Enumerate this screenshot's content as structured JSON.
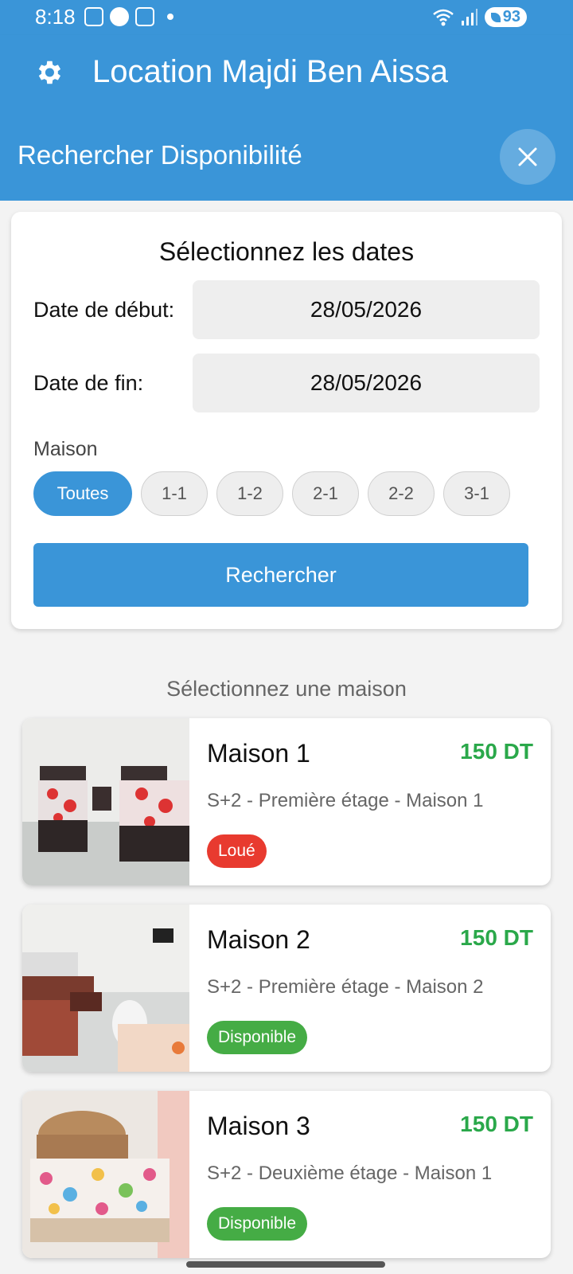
{
  "status_bar": {
    "time": "8:18",
    "battery": "93"
  },
  "app_bar": {
    "title": "Location Majdi Ben Aissa",
    "settings_icon": "gear-icon"
  },
  "sub_header": {
    "title": "Rechercher Disponibilité",
    "close_icon": "close-icon"
  },
  "date_card": {
    "title": "Sélectionnez les dates",
    "start_label": "Date de début:",
    "start_value": "28/05/2026",
    "end_label": "Date de fin:",
    "end_value": "28/05/2026",
    "maison_label": "Maison",
    "chips": [
      "Toutes",
      "1-1",
      "1-2",
      "2-1",
      "2-2",
      "3-1"
    ],
    "selected_chip": "Toutes",
    "search_label": "Rechercher"
  },
  "list": {
    "section_label": "Sélectionnez une maison",
    "houses": [
      {
        "name": "Maison 1",
        "price": "150 DT",
        "desc": "S+2 - Première étage - Maison 1",
        "status": "Loué",
        "status_color": "#e83a2f"
      },
      {
        "name": "Maison 2",
        "price": "150 DT",
        "desc": "S+2 - Première étage - Maison 2",
        "status": "Disponible",
        "status_color": "#45ac45"
      },
      {
        "name": "Maison 3",
        "price": "150 DT",
        "desc": "S+2 - Deuxième étage - Maison 1",
        "status": "Disponible",
        "status_color": "#45ac45"
      }
    ]
  },
  "colors": {
    "primary": "#3a95d8",
    "price": "#2aa84a",
    "rented": "#e83a2f",
    "available": "#45ac45"
  }
}
